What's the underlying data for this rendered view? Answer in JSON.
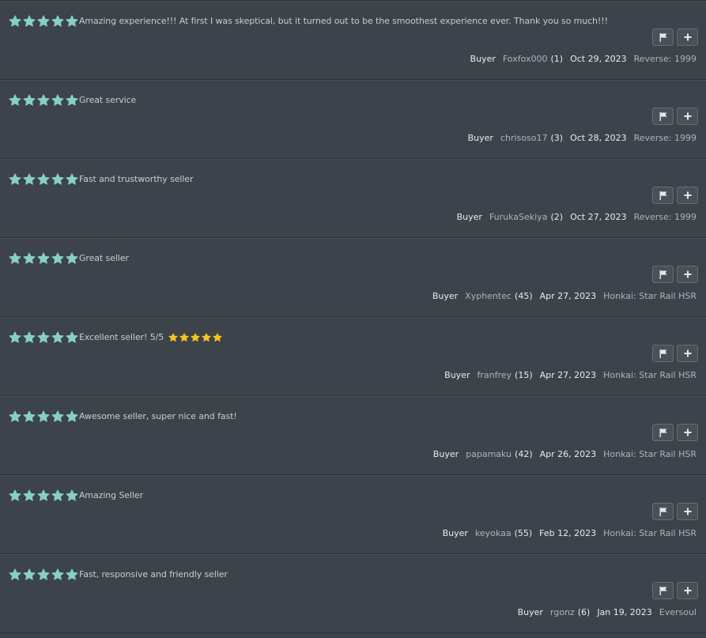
{
  "colors": {
    "background": "#3d434b",
    "rating_star": "#86cfc4",
    "emoji_star": "#f7c51b",
    "divider": "#2c3138"
  },
  "icons": {
    "rating": "star-icon",
    "report": "flag-icon",
    "expand": "plus-icon"
  },
  "feedback": [
    {
      "rating": 5,
      "comment": "Amazing experience!!! At first I was skeptical, but it turned out to be the smoothest experience ever. Thank you so much!!!",
      "emoji_stars": 0,
      "role": "Buyer",
      "username": "Foxfox000",
      "count": "(1)",
      "date": "Oct 29, 2023",
      "item": "Reverse: 1999"
    },
    {
      "rating": 5,
      "comment": "Great service",
      "emoji_stars": 0,
      "role": "Buyer",
      "username": "chrisoso17",
      "count": "(3)",
      "date": "Oct 28, 2023",
      "item": "Reverse: 1999"
    },
    {
      "rating": 5,
      "comment": "Fast and trustworthy seller",
      "emoji_stars": 0,
      "role": "Buyer",
      "username": "FurukaSekiya",
      "count": "(2)",
      "date": "Oct 27, 2023",
      "item": "Reverse: 1999"
    },
    {
      "rating": 5,
      "comment": "Great seller",
      "emoji_stars": 0,
      "role": "Buyer",
      "username": "Xyphentec",
      "count": "(45)",
      "date": "Apr 27, 2023",
      "item": "Honkai: Star Rail HSR"
    },
    {
      "rating": 5,
      "comment": "Excellent seller! 5/5",
      "emoji_stars": 5,
      "role": "Buyer",
      "username": "franfrey",
      "count": "(15)",
      "date": "Apr 27, 2023",
      "item": "Honkai: Star Rail HSR"
    },
    {
      "rating": 5,
      "comment": "Awesome seller, super nice and fast!",
      "emoji_stars": 0,
      "role": "Buyer",
      "username": "papamaku",
      "count": "(42)",
      "date": "Apr 26, 2023",
      "item": "Honkai: Star Rail HSR"
    },
    {
      "rating": 5,
      "comment": "Amazing Seller",
      "emoji_stars": 0,
      "role": "Buyer",
      "username": "keyokaa",
      "count": "(55)",
      "date": "Feb 12, 2023",
      "item": "Honkai: Star Rail HSR"
    },
    {
      "rating": 5,
      "comment": "Fast, responsive and friendly seller",
      "emoji_stars": 0,
      "role": "Buyer",
      "username": "rgonz",
      "count": "(6)",
      "date": "Jan 19, 2023",
      "item": "Eversoul"
    }
  ]
}
